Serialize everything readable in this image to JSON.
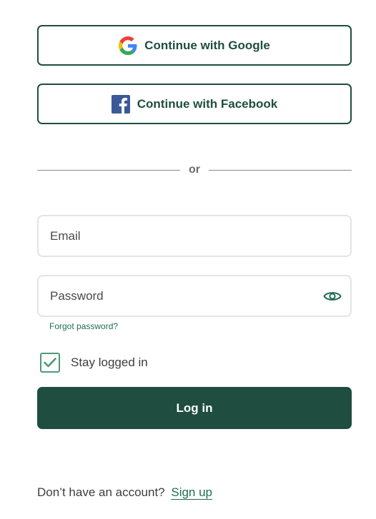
{
  "social": {
    "google_label": "Continue with Google",
    "google_icon": "google-icon",
    "facebook_label": "Continue with Facebook",
    "facebook_icon": "facebook-icon"
  },
  "divider": {
    "text": "or"
  },
  "form": {
    "email_placeholder": "Email",
    "email_value": "",
    "password_placeholder": "Password",
    "password_value": "",
    "password_toggle_icon": "eye-icon",
    "forgot_label": "Forgot password?",
    "stay_logged_in_label": "Stay logged in",
    "stay_logged_in_checked": true,
    "login_label": "Log in"
  },
  "footer": {
    "prompt": "Don’t have an account?",
    "signup_label": "Sign up"
  },
  "colors": {
    "primary": "#1f4d40",
    "link": "#1f6e52",
    "checkbox_border": "#4a9a78",
    "field_border": "#e4e4e4",
    "facebook_blue": "#3b5998"
  }
}
